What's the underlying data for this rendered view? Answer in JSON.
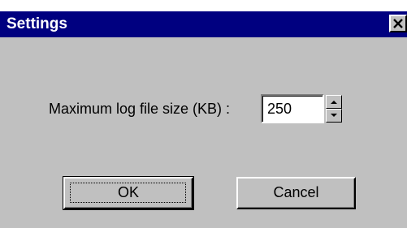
{
  "window": {
    "title": "Settings"
  },
  "icons": {
    "close": "close-icon",
    "spin_up": "arrow-up-icon",
    "spin_down": "arrow-down-icon"
  },
  "colors": {
    "titlebar": "#000080",
    "face": "#c0c0c0"
  },
  "form": {
    "log_size_label": "Maximum log file size (KB) :",
    "log_size_value": "250"
  },
  "buttons": {
    "ok_label": "OK",
    "cancel_label": "Cancel"
  }
}
